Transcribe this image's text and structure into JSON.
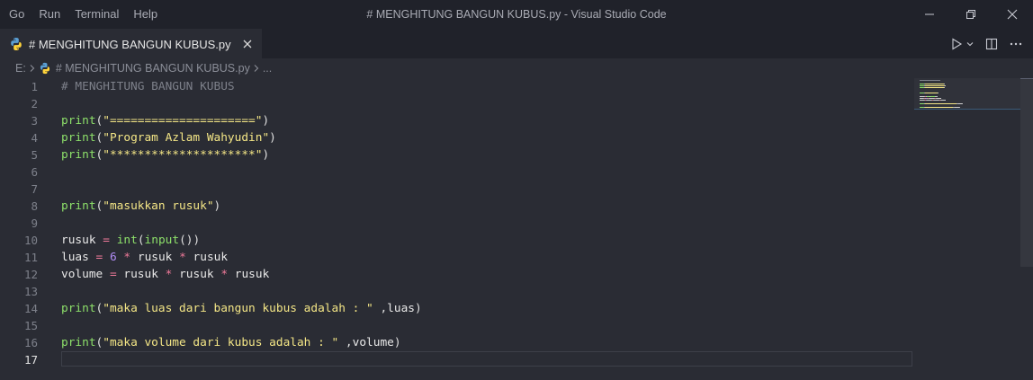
{
  "menu": [
    "Go",
    "Run",
    "Terminal",
    "Help"
  ],
  "window_title": "# MENGHITUNG BANGUN KUBUS.py - Visual Studio Code",
  "tab": {
    "label": "# MENGHITUNG BANGUN KUBUS.py",
    "icon": "python-icon"
  },
  "breadcrumb": {
    "drive": "E:",
    "file": "# MENGHITUNG BANGUN KUBUS.py",
    "more": "..."
  },
  "editor": {
    "active_line": 17,
    "lines": [
      {
        "n": "1",
        "tokens": [
          {
            "t": "comment",
            "v": "# MENGHITUNG BANGUN KUBUS"
          }
        ]
      },
      {
        "n": "2",
        "tokens": []
      },
      {
        "n": "3",
        "tokens": [
          {
            "t": "fn",
            "v": "print"
          },
          {
            "t": "punc",
            "v": "("
          },
          {
            "t": "str",
            "v": "\"=====================\""
          },
          {
            "t": "punc",
            "v": ")"
          }
        ]
      },
      {
        "n": "4",
        "tokens": [
          {
            "t": "fn",
            "v": "print"
          },
          {
            "t": "punc",
            "v": "("
          },
          {
            "t": "str",
            "v": "\"Program Azlam Wahyudin\""
          },
          {
            "t": "punc",
            "v": ")"
          }
        ]
      },
      {
        "n": "5",
        "tokens": [
          {
            "t": "fn",
            "v": "print"
          },
          {
            "t": "punc",
            "v": "("
          },
          {
            "t": "str",
            "v": "\"*********************\""
          },
          {
            "t": "punc",
            "v": ")"
          }
        ]
      },
      {
        "n": "6",
        "tokens": []
      },
      {
        "n": "7",
        "tokens": []
      },
      {
        "n": "8",
        "tokens": [
          {
            "t": "fn",
            "v": "print"
          },
          {
            "t": "punc",
            "v": "("
          },
          {
            "t": "str",
            "v": "\"masukkan rusuk\""
          },
          {
            "t": "punc",
            "v": ")"
          }
        ]
      },
      {
        "n": "9",
        "tokens": []
      },
      {
        "n": "10",
        "tokens": [
          {
            "t": "var",
            "v": "rusuk"
          },
          {
            "t": "punc",
            "v": " "
          },
          {
            "t": "op",
            "v": "="
          },
          {
            "t": "punc",
            "v": " "
          },
          {
            "t": "fn",
            "v": "int"
          },
          {
            "t": "punc",
            "v": "("
          },
          {
            "t": "fn",
            "v": "input"
          },
          {
            "t": "punc",
            "v": "())"
          }
        ]
      },
      {
        "n": "11",
        "tokens": [
          {
            "t": "var",
            "v": "luas"
          },
          {
            "t": "punc",
            "v": " "
          },
          {
            "t": "op",
            "v": "="
          },
          {
            "t": "punc",
            "v": " "
          },
          {
            "t": "num",
            "v": "6"
          },
          {
            "t": "punc",
            "v": " "
          },
          {
            "t": "op",
            "v": "*"
          },
          {
            "t": "punc",
            "v": " "
          },
          {
            "t": "var",
            "v": "rusuk"
          },
          {
            "t": "punc",
            "v": " "
          },
          {
            "t": "op",
            "v": "*"
          },
          {
            "t": "punc",
            "v": " "
          },
          {
            "t": "var",
            "v": "rusuk"
          }
        ]
      },
      {
        "n": "12",
        "tokens": [
          {
            "t": "var",
            "v": "volume"
          },
          {
            "t": "punc",
            "v": " "
          },
          {
            "t": "op",
            "v": "="
          },
          {
            "t": "punc",
            "v": " "
          },
          {
            "t": "var",
            "v": "rusuk"
          },
          {
            "t": "punc",
            "v": " "
          },
          {
            "t": "op",
            "v": "*"
          },
          {
            "t": "punc",
            "v": " "
          },
          {
            "t": "var",
            "v": "rusuk"
          },
          {
            "t": "punc",
            "v": " "
          },
          {
            "t": "op",
            "v": "*"
          },
          {
            "t": "punc",
            "v": " "
          },
          {
            "t": "var",
            "v": "rusuk"
          }
        ]
      },
      {
        "n": "13",
        "tokens": []
      },
      {
        "n": "14",
        "tokens": [
          {
            "t": "fn",
            "v": "print"
          },
          {
            "t": "punc",
            "v": "("
          },
          {
            "t": "str",
            "v": "\"maka luas dari bangun kubus adalah : \""
          },
          {
            "t": "punc",
            "v": " ,"
          },
          {
            "t": "var",
            "v": "luas"
          },
          {
            "t": "punc",
            "v": ")"
          }
        ]
      },
      {
        "n": "15",
        "tokens": []
      },
      {
        "n": "16",
        "tokens": [
          {
            "t": "fn",
            "v": "print"
          },
          {
            "t": "punc",
            "v": "("
          },
          {
            "t": "str",
            "v": "\"maka volume dari kubus adalah : \""
          },
          {
            "t": "punc",
            "v": " ,"
          },
          {
            "t": "var",
            "v": "volume"
          },
          {
            "t": "punc",
            "v": ")"
          }
        ]
      },
      {
        "n": "17",
        "tokens": []
      }
    ]
  },
  "colors": {
    "background": "#2a2c34",
    "titlebar": "#20222a",
    "function": "#8de06a",
    "string": "#f4e686",
    "operator": "#f07a9a",
    "number": "#b08cf5",
    "comment": "#7d808a"
  }
}
